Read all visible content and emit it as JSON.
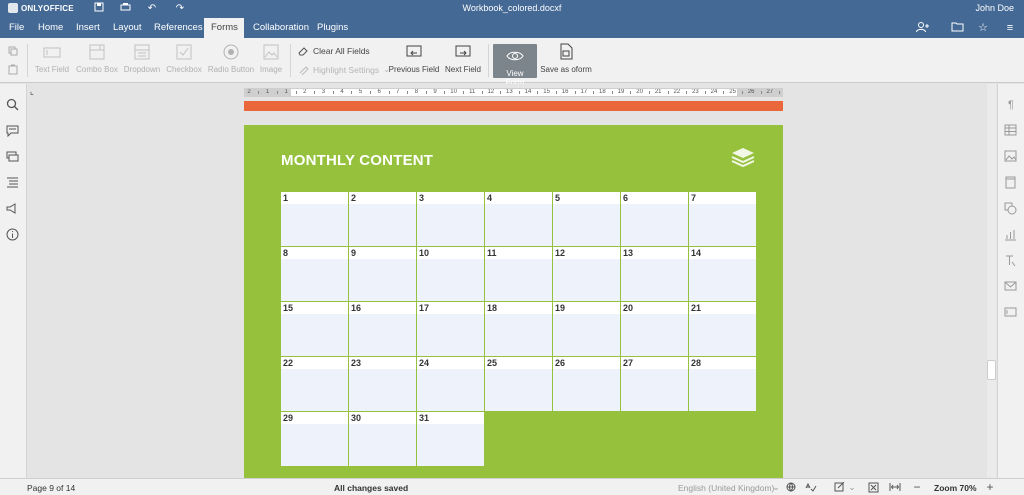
{
  "titlebar": {
    "brand": "ONLYOFFICE",
    "document_title": "Workbook_colored.docxf",
    "user_name": "John Doe"
  },
  "menu": {
    "tabs": [
      "File",
      "Home",
      "Insert",
      "Layout",
      "References",
      "Forms",
      "Collaboration",
      "Plugins"
    ],
    "active_tab": "Forms"
  },
  "toolbar": {
    "text_field": "Text Field",
    "combo_box": "Combo Box",
    "dropdown": "Dropdown",
    "checkbox": "Checkbox",
    "radio_button": "Radio Button",
    "image": "Image",
    "clear_all_fields": "Clear All Fields",
    "highlight_settings": "Highlight Settings",
    "previous_field": "Previous Field",
    "next_field": "Next Field",
    "view_form": "View Form",
    "save_as_oform": "Save as oform"
  },
  "ruler": {
    "numbers": [
      "2",
      "1",
      "1",
      "2",
      "3",
      "4",
      "5",
      "6",
      "7",
      "8",
      "9",
      "10",
      "11",
      "12",
      "13",
      "14",
      "15",
      "16",
      "17",
      "18",
      "19",
      "20",
      "21",
      "22",
      "23",
      "24",
      "25",
      "26",
      "27"
    ]
  },
  "document": {
    "heading": "MONTHLY CONTENT",
    "days": [
      "1",
      "2",
      "3",
      "4",
      "5",
      "6",
      "7",
      "8",
      "9",
      "10",
      "11",
      "12",
      "13",
      "14",
      "15",
      "16",
      "17",
      "18",
      "19",
      "20",
      "21",
      "22",
      "23",
      "24",
      "25",
      "26",
      "27",
      "28",
      "29",
      "30",
      "31"
    ]
  },
  "status": {
    "page_info": "Page 9 of 14",
    "save_state": "All changes saved",
    "language": "English (United Kingdom)",
    "zoom": "Zoom 70%"
  },
  "colors": {
    "header": "#446995",
    "page_green": "#95c13d",
    "accent_orange": "#e9673a",
    "cell_fill": "#eef2fa"
  }
}
